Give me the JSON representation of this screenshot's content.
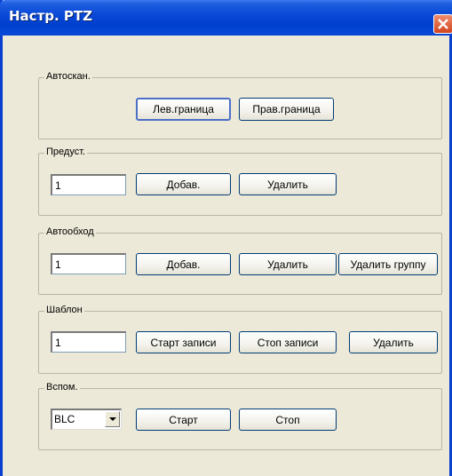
{
  "window": {
    "title": "Настр. PTZ"
  },
  "autoscan": {
    "title": "Автоскан.",
    "left_limit": "Лев.граница",
    "right_limit": "Прав.граница"
  },
  "preset": {
    "title": "Предуст.",
    "input_value": "1",
    "add": "Добав.",
    "delete": "Удалить"
  },
  "tour": {
    "title": "Автообход",
    "input_value": "1",
    "add": "Добав.",
    "delete": "Удалить",
    "delete_group": "Удалить группу"
  },
  "pattern": {
    "title": "Шаблон",
    "input_value": "1",
    "start_record": "Старт записи",
    "stop_record": "Стоп записи",
    "delete": "Удалить"
  },
  "aux": {
    "title": "Вспом.",
    "selected": "BLC",
    "start": "Старт",
    "stop": "Стоп"
  }
}
